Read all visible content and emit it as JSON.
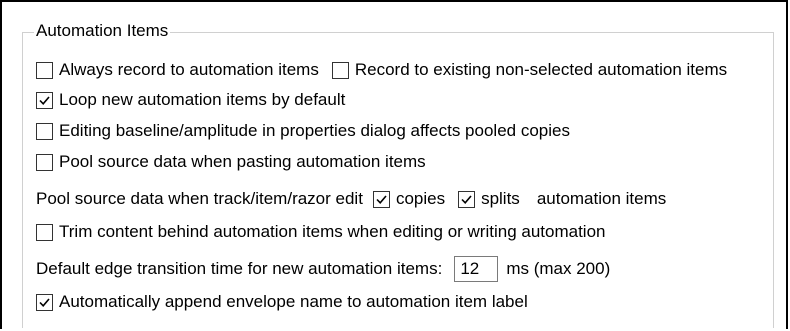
{
  "group": {
    "title": "Automation Items"
  },
  "options": {
    "always_record": {
      "label": "Always record to automation items",
      "checked": false
    },
    "record_existing": {
      "label": "Record to existing non-selected automation items",
      "checked": false
    },
    "loop_new": {
      "label": "Loop new automation items by default",
      "checked": true
    },
    "editing_baseline": {
      "label": "Editing baseline/amplitude in properties dialog affects pooled copies",
      "checked": false
    },
    "pool_paste": {
      "label": "Pool source data when pasting automation items",
      "checked": false
    },
    "pool_edit": {
      "prefix": "Pool source data when track/item/razor edit",
      "copies": {
        "label": "copies",
        "checked": true
      },
      "splits": {
        "label": "splits",
        "checked": true
      },
      "suffix": "automation items"
    },
    "trim_content": {
      "label": "Trim content behind automation items when editing or writing automation",
      "checked": false
    },
    "edge_transition": {
      "label": "Default edge transition time for new automation items:",
      "value": "12",
      "unit": "ms (max 200)"
    },
    "append_name": {
      "label": "Automatically append envelope name to automation item label",
      "checked": true
    }
  }
}
